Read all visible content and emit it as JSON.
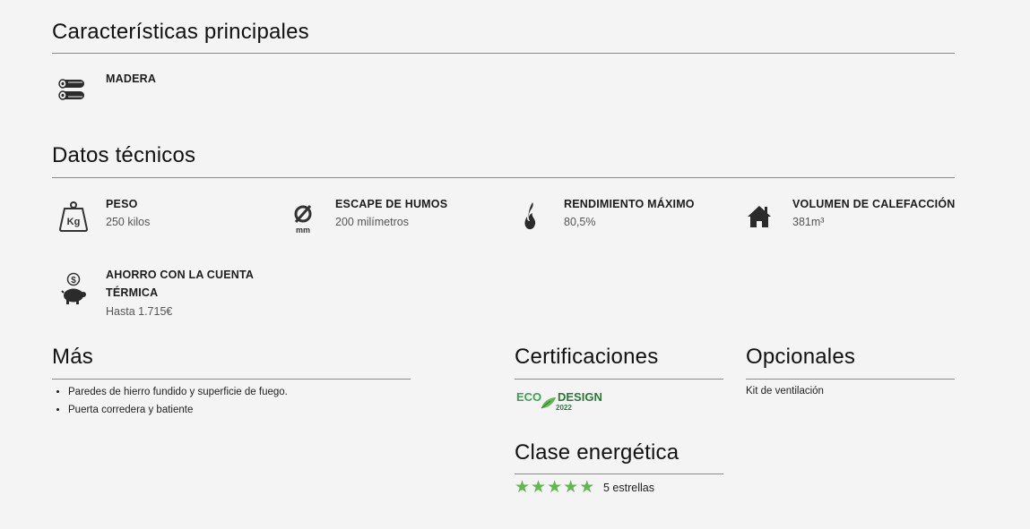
{
  "main_features": {
    "title": "Características principales",
    "items": [
      {
        "icon": "logs-icon",
        "label": "MADERA"
      }
    ]
  },
  "tech": {
    "title": "Datos técnicos",
    "items": [
      {
        "icon": "weight-kg-icon",
        "label": "PESO",
        "value": "250 kilos"
      },
      {
        "icon": "diameter-mm-icon",
        "label": "ESCAPE DE HUMOS",
        "value": "200 milímetros"
      },
      {
        "icon": "flame-icon",
        "label": "RENDIMIENTO MÁXIMO",
        "value": "80,5%"
      },
      {
        "icon": "house-icon",
        "label": "VOLUMEN DE CALEFACCIÓN",
        "value": "381m³"
      },
      {
        "icon": "piggy-bank-icon",
        "label_line1": "AHORRO CON LA CUENTA",
        "label_line2": "TÉRMICA",
        "value": "Hasta 1.715€"
      }
    ]
  },
  "more": {
    "title": "Más",
    "bullets": [
      "Paredes de hierro fundido y superficie de fuego.",
      "Puerta corredera y batiente"
    ]
  },
  "certifications": {
    "title": "Certificaciones",
    "logo": {
      "word1": "ECO",
      "word2": "DESIGN",
      "year": "2022",
      "color_green": "#3aa34a",
      "color_dark": "#2a7a34"
    }
  },
  "energy_class": {
    "title": "Clase energética",
    "stars": 5,
    "star_color": "#5fb94f",
    "text": "5 estrellas"
  },
  "optionals": {
    "title": "Opcionales",
    "text": "Kit de ventilación"
  }
}
